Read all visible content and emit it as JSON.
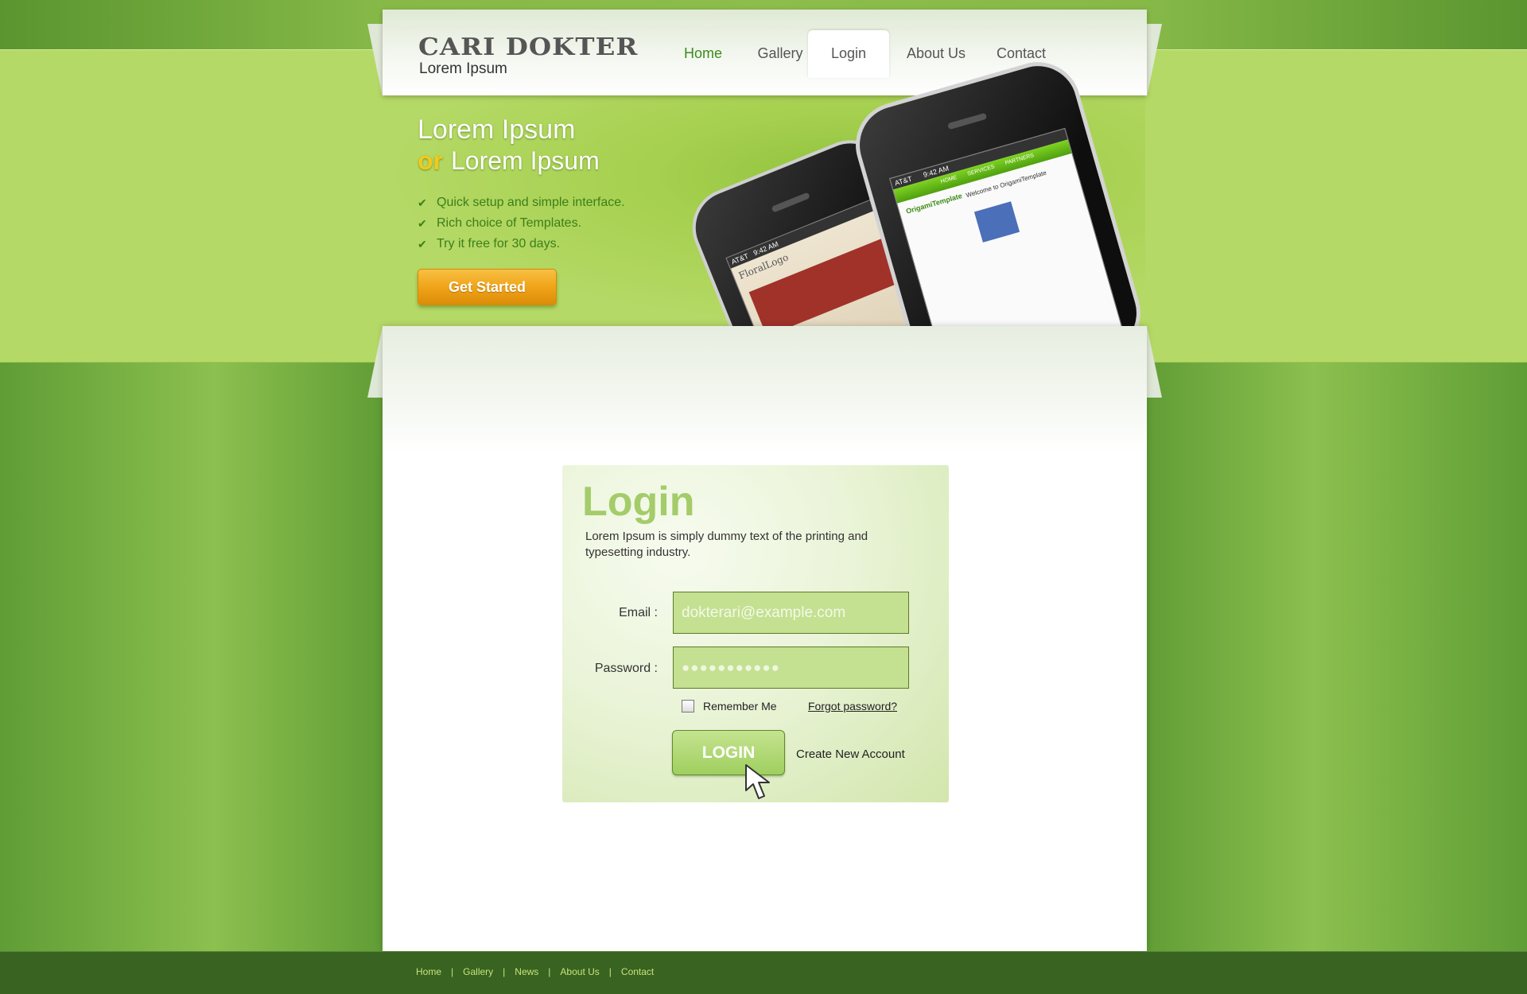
{
  "brand": {
    "title": "CARI DOKTER",
    "subtitle": "Lorem Ipsum"
  },
  "nav": {
    "items": [
      {
        "label": "Home"
      },
      {
        "label": "Gallery"
      },
      {
        "label": "Login"
      },
      {
        "label": "About Us"
      },
      {
        "label": "Contact"
      }
    ],
    "active": "Login"
  },
  "hero": {
    "title_line1": "Lorem Ipsum",
    "title_or": "or",
    "title_line2": "Lorem Ipsum",
    "features": [
      "Quick setup and simple interface.",
      "Rich choice of Templates.",
      "Try it free for 30 days."
    ],
    "cta_label": "Get Started"
  },
  "phones": {
    "front": {
      "time": "9:42 AM",
      "carrier": "AT&T",
      "logo": "OrigamiTemplate",
      "tabs": [
        "HOME",
        "SERVICES",
        "PARTNERS"
      ],
      "headline": "Welcome to OrigamiTemplate"
    },
    "back": {
      "time": "9:42 AM",
      "carrier": "AT&T",
      "logo": "FloralLogo"
    }
  },
  "login": {
    "title": "Login",
    "description": "Lorem Ipsum is simply dummy text of the printing and typesetting industry.",
    "email_label": "Email :",
    "email_placeholder": "dokterari@example.com",
    "password_label": "Password :",
    "password_value": "●●●●●●●●●●●",
    "remember_label": "Remember Me",
    "remember_checked": false,
    "forgot_label": "Forgot password?",
    "login_button": "LOGIN",
    "create_account": "Create New Account"
  },
  "footer": {
    "links": [
      "Home",
      "Gallery",
      "News",
      "About Us",
      "Contact"
    ]
  },
  "colors": {
    "accent_green": "#3b8c1e",
    "band_green": "#b5d966",
    "orange_button": "#f0a419",
    "footer_bg": "#386321"
  }
}
